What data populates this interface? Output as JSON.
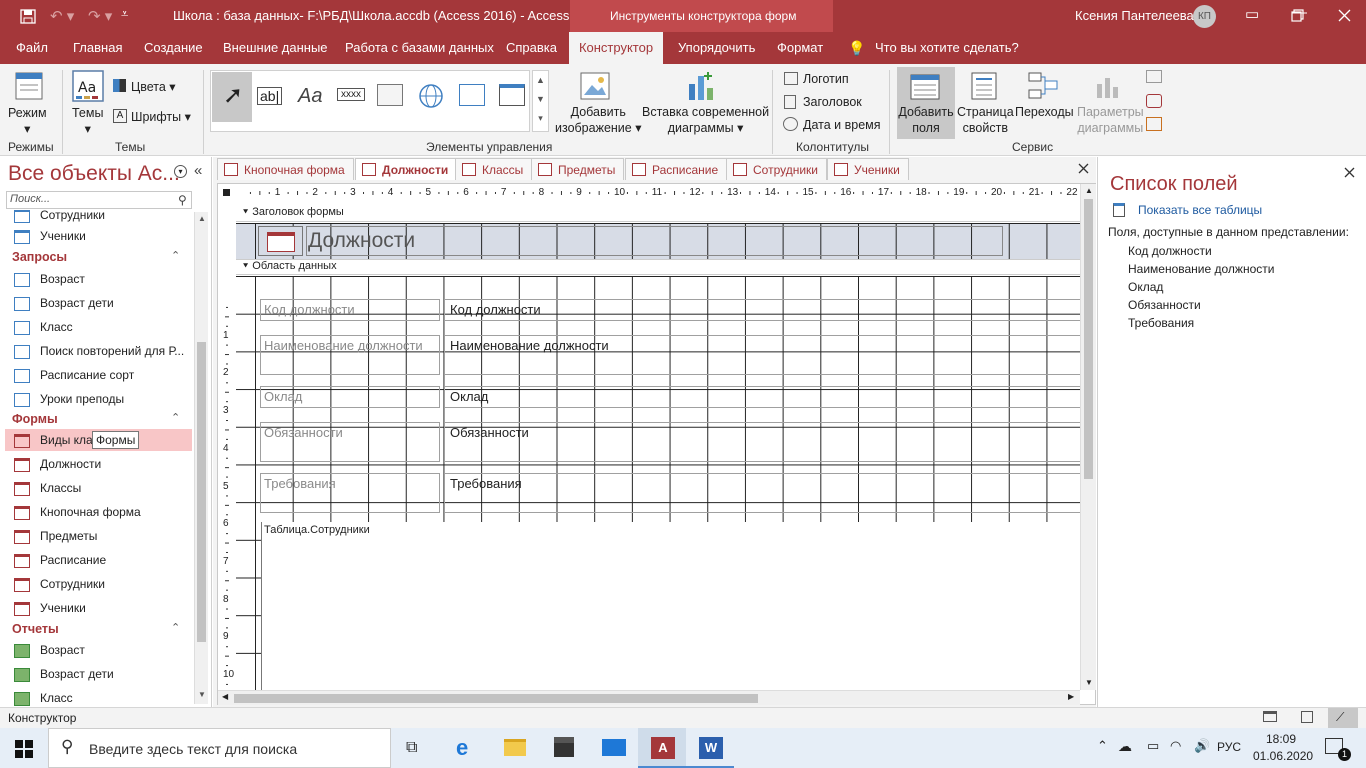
{
  "titlebar": {
    "title": "Школа : база данных- F:\\РБД\\Школа.accdb (Access 2016)  -  Access",
    "context_tool": "Инструменты конструктора форм",
    "user": "Ксения Пантелеева",
    "user_initials": "КП"
  },
  "ribbon_tabs": [
    "Файл",
    "Главная",
    "Создание",
    "Внешние данные",
    "Работа с базами данных",
    "Справка",
    "Конструктор",
    "Упорядочить",
    "Формат"
  ],
  "tell_me": "Что вы хотите сделать?",
  "ribbon": {
    "mode_label": "Режим",
    "modes_group": "Режимы",
    "themes_label": "Темы",
    "colors_label": "Цвета",
    "fonts_label": "Шрифты",
    "themes_group": "Темы",
    "controls_group": "Элементы управления",
    "add_image": [
      "Добавить",
      "изображение"
    ],
    "insert_chart": [
      "Вставка современной",
      "диаграммы"
    ],
    "logo": "Логотип",
    "heading": "Заголовок",
    "datetime": "Дата и время",
    "headers_group": "Колонтитулы",
    "add_fields": [
      "Добавить",
      "поля"
    ],
    "property_sheet": [
      "Страница",
      "свойств"
    ],
    "transitions": "Переходы",
    "chart_params": [
      "Параметры",
      "диаграммы"
    ],
    "service_group": "Сервис"
  },
  "nav": {
    "title": "Все объекты Ac...",
    "search_placeholder": "Поиск...",
    "partial_top": "Сотрудники",
    "tables_tail": [
      "Ученики"
    ],
    "queries_title": "Запросы",
    "queries": [
      "Возраст",
      "Возраст дети",
      "Класс",
      "Поиск повторений для Р...",
      "Расписание сорт",
      "Уроки преподы"
    ],
    "forms_title": "Формы",
    "forms": [
      "Виды клас",
      "Должности",
      "Классы",
      "Кнопочная форма",
      "Предметы",
      "Расписание",
      "Сотрудники",
      "Ученики"
    ],
    "tooltip": "Формы",
    "reports_title": "Отчеты",
    "reports": [
      "Возраст",
      "Возраст дети",
      "Класс"
    ]
  },
  "doc_tabs": [
    "Кнопочная форма",
    "Должности",
    "Классы",
    "Предметы",
    "Расписание",
    "Сотрудники",
    "Ученики"
  ],
  "design": {
    "header_section": "Заголовок формы",
    "form_title": "Должности",
    "detail_section": "Область данных",
    "ruler_numbers": [
      "1",
      "2",
      "3",
      "4",
      "5",
      "6",
      "7",
      "8",
      "9",
      "10",
      "11",
      "12",
      "13",
      "14",
      "15",
      "16",
      "17",
      "18",
      "19",
      "20",
      "21",
      "22"
    ],
    "vruler_numbers": [
      "1",
      "2",
      "3",
      "4",
      "5",
      "6",
      "7",
      "8",
      "9",
      "10"
    ],
    "fields": [
      {
        "label": "Код должности",
        "value": "Код должности"
      },
      {
        "label": "Наименование должности",
        "value": "Наименование должности"
      },
      {
        "label": "Оклад",
        "value": "Оклад"
      },
      {
        "label": "Обязанности",
        "value": "Обязанности"
      },
      {
        "label": "Требования",
        "value": "Требования"
      }
    ],
    "subform_label": "Таблица.Сотрудники"
  },
  "fieldlist": {
    "title": "Список полей",
    "show_all": "Показать все таблицы",
    "available": "Поля, доступные в данном представлении:",
    "fields": [
      "Код должности",
      "Наименование должности",
      "Оклад",
      "Обязанности",
      "Требования"
    ]
  },
  "status": {
    "mode": "Конструктор"
  },
  "taskbar": {
    "search_placeholder": "Введите здесь текст для поиска",
    "lang": "РУС",
    "time": "18:09",
    "date": "01.06.2020",
    "notifications": "1"
  },
  "colors": {
    "accent": "#a4373a",
    "selected_nav": "#f8c6c7"
  }
}
